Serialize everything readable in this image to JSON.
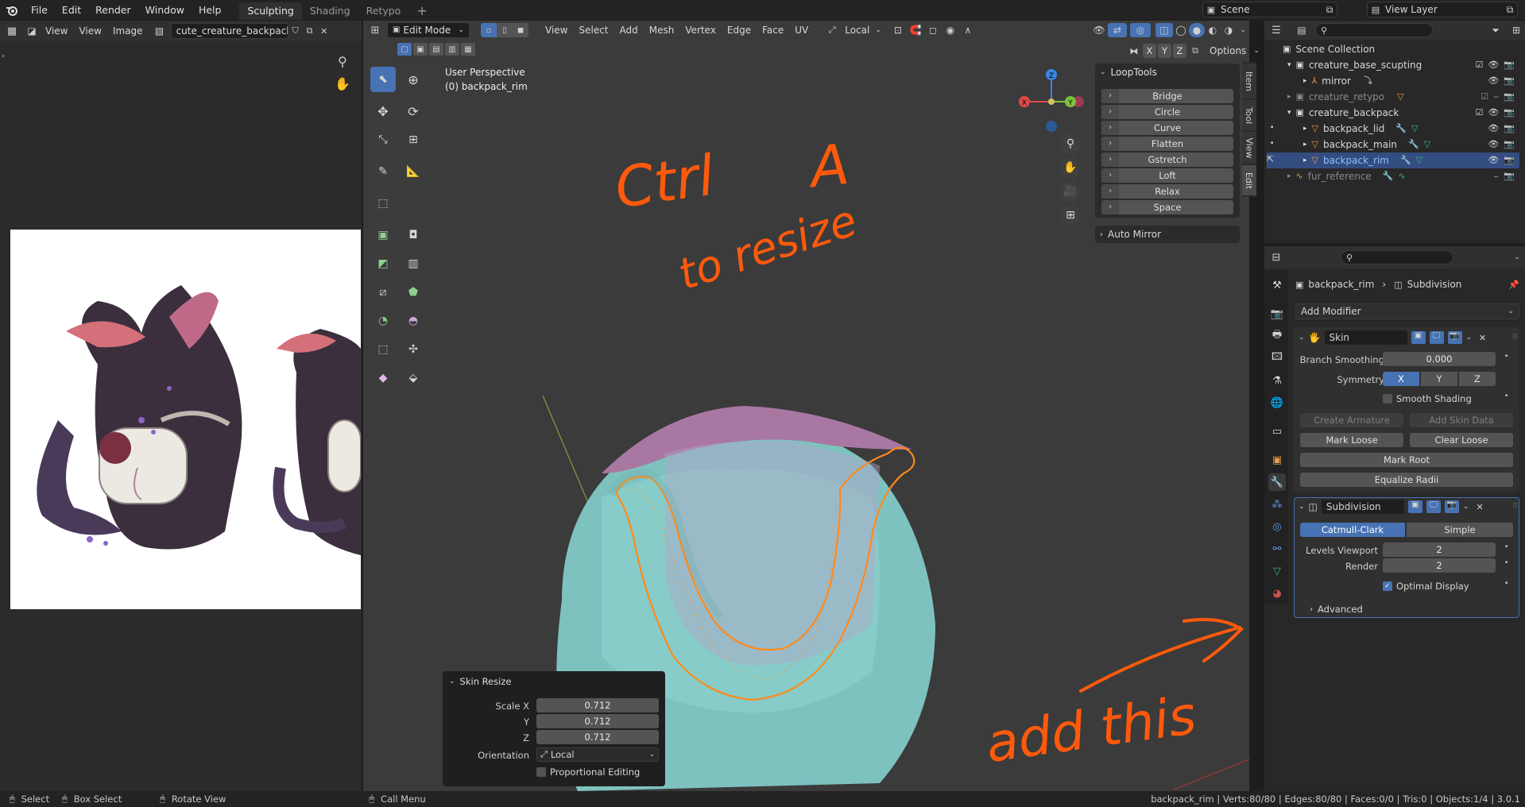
{
  "topbar": {
    "menu": [
      "File",
      "Edit",
      "Render",
      "Window",
      "Help"
    ],
    "workspaces": [
      "Sculpting",
      "Shading",
      "Retypo"
    ],
    "active_workspace": "Sculpting",
    "scene": "Scene",
    "view_layer": "View Layer"
  },
  "image_editor": {
    "menus": [
      "View",
      "View",
      "Image"
    ],
    "image_name": "cute_creature_backpack.jpg"
  },
  "viewport": {
    "mode": "Edit Mode",
    "menus": [
      "View",
      "Select",
      "Add",
      "Mesh",
      "Vertex",
      "Edge",
      "Face",
      "UV"
    ],
    "orientation": "Local",
    "perspective": "User Perspective",
    "object_label": "(0) backpack_rim",
    "axes": [
      "X",
      "Y",
      "Z"
    ],
    "options": "Options"
  },
  "looptools": {
    "title": "LoopTools",
    "buttons": [
      "Bridge",
      "Circle",
      "Curve",
      "Flatten",
      "Gstretch",
      "Loft",
      "Relax",
      "Space"
    ],
    "auto_mirror": "Auto Mirror"
  },
  "side_tabs": [
    "Item",
    "Tool",
    "View",
    "Edit"
  ],
  "skin_resize": {
    "title": "Skin Resize",
    "scale_x_label": "Scale X",
    "scale_x": "0.712",
    "y_label": "Y",
    "y": "0.712",
    "z_label": "Z",
    "z": "0.712",
    "orientation_label": "Orientation",
    "orientation": "Local",
    "proportional": "Proportional Editing"
  },
  "annotations": {
    "ctrl": "Ctrl",
    "a": "A",
    "to_resize": "to resize",
    "add_this": "add this"
  },
  "outliner": {
    "root": "Scene Collection",
    "items": [
      {
        "name": "creature_base_scupting",
        "level": 1
      },
      {
        "name": "mirror",
        "level": 2
      },
      {
        "name": "creature_retypo",
        "level": 1
      },
      {
        "name": "creature_backpack",
        "level": 1
      },
      {
        "name": "backpack_lid",
        "level": 2
      },
      {
        "name": "backpack_main",
        "level": 2
      },
      {
        "name": "backpack_rim",
        "level": 2
      },
      {
        "name": "fur_reference",
        "level": 1
      }
    ]
  },
  "properties": {
    "object": "backpack_rim",
    "modifier_crumb": "Subdivision",
    "add_modifier": "Add Modifier",
    "skin": {
      "name": "Skin",
      "branch_smoothing_label": "Branch Smoothing",
      "branch_smoothing": "0.000",
      "symmetry_label": "Symmetry",
      "symmetry": [
        "X",
        "Y",
        "Z"
      ],
      "smooth_shading": "Smooth Shading",
      "create_armature": "Create Armature",
      "add_skin_data": "Add Skin Data",
      "mark_loose": "Mark Loose",
      "clear_loose": "Clear Loose",
      "mark_root": "Mark Root",
      "equalize_radii": "Equalize Radii"
    },
    "subdivision": {
      "name": "Subdivision",
      "catmull": "Catmull-Clark",
      "simple": "Simple",
      "levels_viewport_label": "Levels Viewport",
      "levels_viewport": "2",
      "render_label": "Render",
      "render": "2",
      "optimal_display": "Optimal Display",
      "advanced": "Advanced"
    }
  },
  "statusbar": {
    "select": "Select",
    "box_select": "Box Select",
    "rotate_view": "Rotate View",
    "call_menu": "Call Menu",
    "stats": "backpack_rim | Verts:80/80 | Edges:80/80 | Faces:0/0 | Tris:0 | Objects:1/4 | 3.0.1"
  },
  "colors": {
    "accent": "#4772b3",
    "annotation": "#ff5a0c",
    "mesh": "#7cc7c4",
    "rim_edge": "#ff8a1a"
  }
}
